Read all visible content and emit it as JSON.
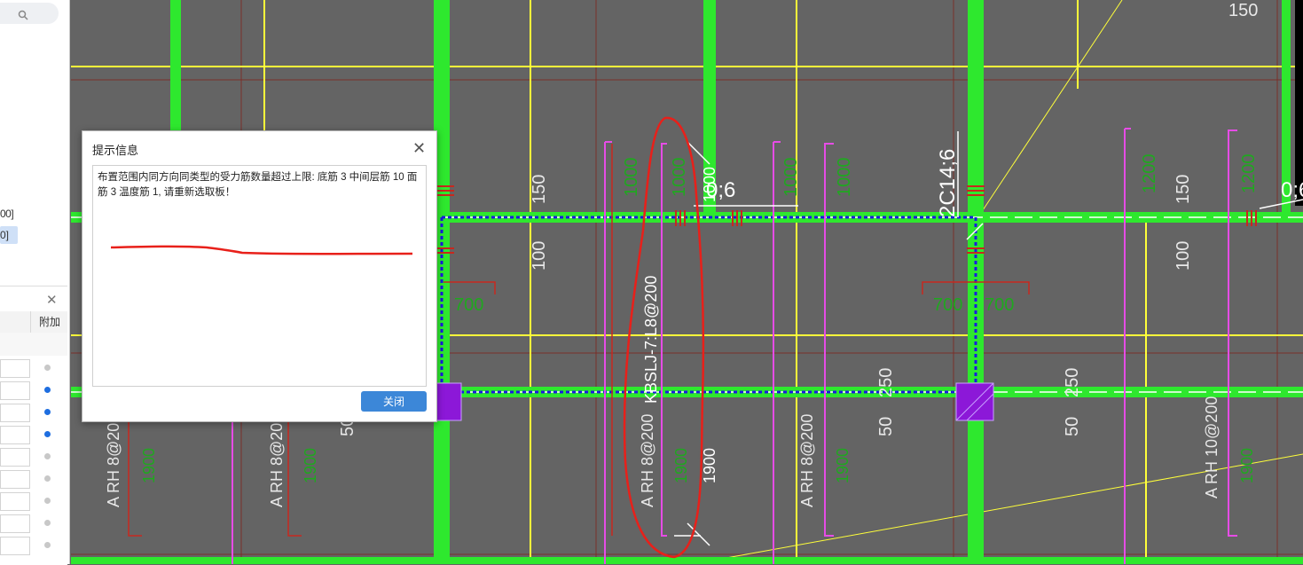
{
  "dialog": {
    "title": "提示信息",
    "message": "布置范围内同方向同类型的受力筋数量超过上限: 底筋 3 中间层筋 10 面筋 3 温度筋 1, 请重新选取板！",
    "close_button": "关闭"
  },
  "side_panel": {
    "item_a": "00]",
    "item_b": "0]",
    "column_header": "附加",
    "radio_states": [
      false,
      true,
      true,
      true,
      false,
      false,
      false,
      false,
      false
    ]
  },
  "drawing": {
    "dims_top": [
      "150"
    ],
    "dims_green": [
      "1000",
      "1000",
      "1000",
      "1000",
      "1000",
      "1200",
      "1200"
    ],
    "dims_white_v": [
      "150",
      "100",
      "150",
      "100",
      "250",
      "250",
      "50",
      "50",
      "50"
    ],
    "dims_700": [
      "700",
      "700",
      "700"
    ],
    "rebar_labels": [
      "0;6",
      "2C14;6",
      "0;6"
    ],
    "slab_label": "KBSLJ-7:L8@200",
    "bar_labels": [
      "A RH 8@200",
      "A RH 8@200",
      "A RH 8@200",
      "A RH 8@200",
      "A RH 10@200"
    ],
    "dims_1900": [
      "1900",
      "1900",
      "1900",
      "1900",
      "1900",
      "1900"
    ],
    "colors": {
      "background": "#646464",
      "beam": "#2ee82e",
      "grid_yellow": "#ffff3a",
      "magenta": "#e64ce6",
      "red": "#c8281e",
      "purple": "#8c18d8"
    }
  }
}
